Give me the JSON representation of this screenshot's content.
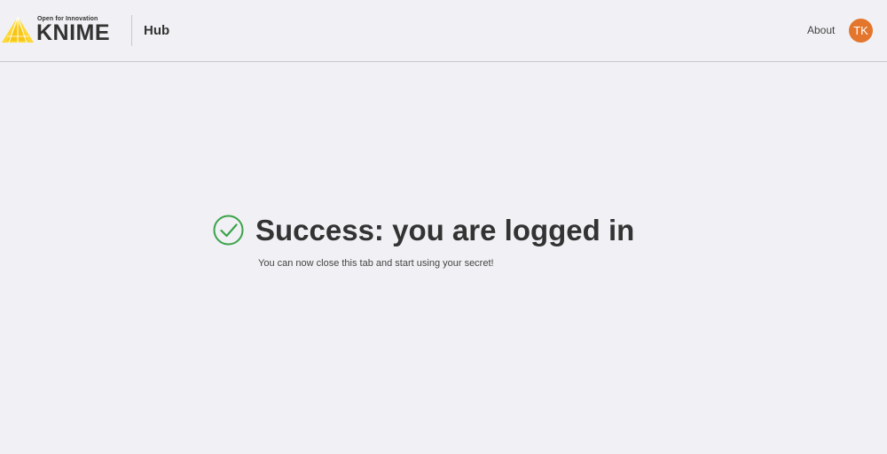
{
  "header": {
    "logo_tagline": "Open for Innovation",
    "logo_word": "KNIME",
    "section": "Hub",
    "about_label": "About",
    "avatar_initials": "TK"
  },
  "main": {
    "title": "Success: you are logged in",
    "subtitle": "You can now close this tab and start using your secret!"
  },
  "colors": {
    "background": "#f1f0f4",
    "avatar": "#e3762c",
    "success": "#3aa34a",
    "logo_yellow": "#fdd835"
  },
  "icons": {
    "logo": "knime-triangle-icon",
    "success": "check-circle-icon"
  }
}
